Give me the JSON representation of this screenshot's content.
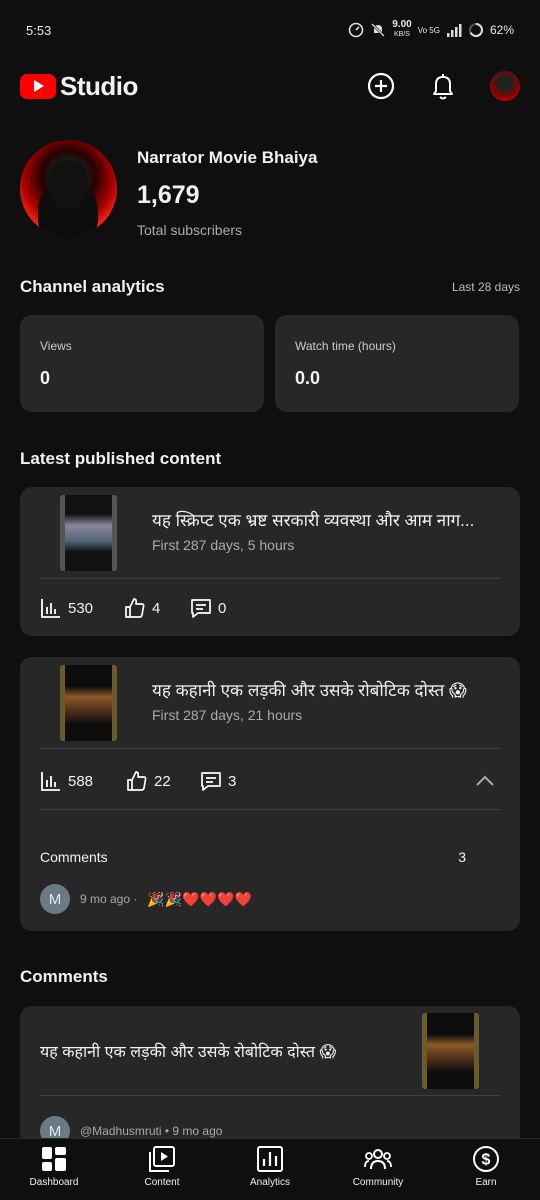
{
  "status": {
    "time": "5:53",
    "net_speed": "9.00",
    "net_unit": "KB/S",
    "net_type": "Vo 5G",
    "battery": "62%"
  },
  "app": {
    "logo_text": "Studio"
  },
  "channel": {
    "name": "Narrator Movie Bhaiya",
    "subscribers": "1,679",
    "subscribers_label": "Total subscribers"
  },
  "analytics": {
    "title": "Channel analytics",
    "period": "Last 28 days",
    "cards": [
      {
        "label": "Views",
        "value": "0"
      },
      {
        "label": "Watch time (hours)",
        "value": "0.0"
      }
    ]
  },
  "latest": {
    "title": "Latest published content",
    "items": [
      {
        "title": "यह स्क्रिप्ट एक भ्रष्ट सरकारी व्यवस्था और आम नाग...",
        "subtitle": "First 287 days, 5 hours",
        "views": "530",
        "likes": "4",
        "comments": "0"
      },
      {
        "title": "यह कहानी एक लड़की और उसके रोबोटिक दोस्त 😱",
        "subtitle": "First 287 days, 21 hours",
        "views": "588",
        "likes": "22",
        "comments": "3",
        "comments_section_label": "Comments",
        "comments_section_count": "3",
        "latest_comment": {
          "avatar_letter": "M",
          "time": "9 mo ago ·",
          "text": "🎉🎉❤️❤️❤️❤️"
        }
      }
    ]
  },
  "comments_section": {
    "title": "Comments",
    "video_title": "यह कहानी एक लड़की और उसके रोबोटिक दोस्त 😱",
    "avatar_letter": "M",
    "author_line": "@Madhusmruti • 9 mo ago"
  },
  "nav": [
    {
      "label": "Dashboard",
      "icon": "dashboard-icon"
    },
    {
      "label": "Content",
      "icon": "content-icon"
    },
    {
      "label": "Analytics",
      "icon": "analytics-icon"
    },
    {
      "label": "Community",
      "icon": "community-icon"
    },
    {
      "label": "Earn",
      "icon": "earn-icon"
    }
  ]
}
